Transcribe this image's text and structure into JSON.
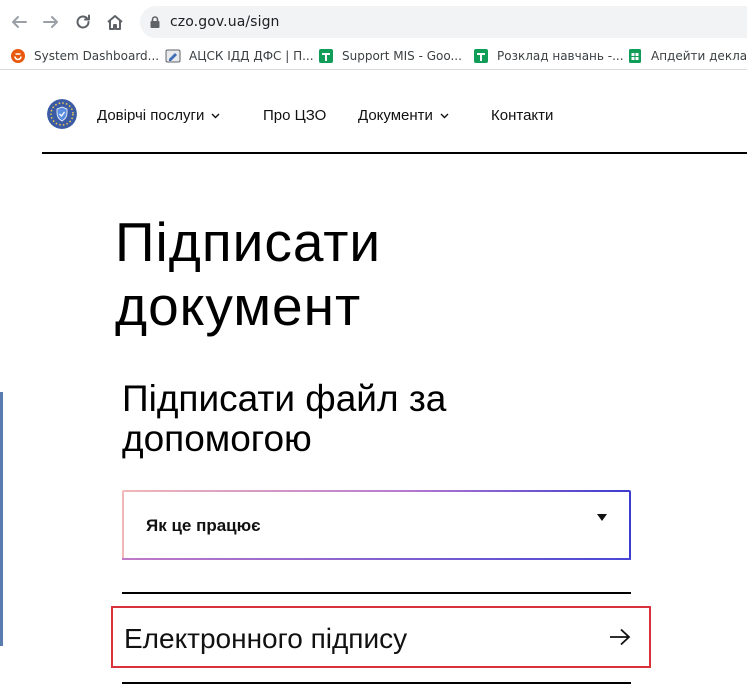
{
  "browser": {
    "url": "czo.gov.ua/sign",
    "bookmarks": [
      {
        "label": "System Dashboard...",
        "icon": "jira-icon",
        "color": "#e8590c"
      },
      {
        "label": "АЦСК ІДД ДФС | П...",
        "icon": "pencil-doc-icon",
        "color": "#5f6368"
      },
      {
        "label": "Support MIS - Goo...",
        "icon": "google-forms-icon",
        "color": "#0f9d58"
      },
      {
        "label": "Розклад навчань -...",
        "icon": "google-forms-icon",
        "color": "#0f9d58"
      },
      {
        "label": "Апдейти декларац",
        "icon": "google-sheets-icon",
        "color": "#0f9d58"
      }
    ]
  },
  "header": {
    "menu": [
      {
        "label": "Довірчі послуги",
        "has_dropdown": true
      },
      {
        "label": "Про ЦЗО",
        "has_dropdown": false
      },
      {
        "label": "Документи",
        "has_dropdown": true
      },
      {
        "label": "Контакти",
        "has_dropdown": false
      }
    ]
  },
  "main": {
    "title_lines": [
      "Підписати",
      "документ"
    ],
    "subtitle_lines": [
      "Підписати файл за",
      "допомогою"
    ],
    "accordion_label": "Як це працює",
    "option_label": "Електронного підпису"
  },
  "colors": {
    "highlight_border": "#d9323a",
    "accordion_gradient_end": "#3c3ccf"
  }
}
